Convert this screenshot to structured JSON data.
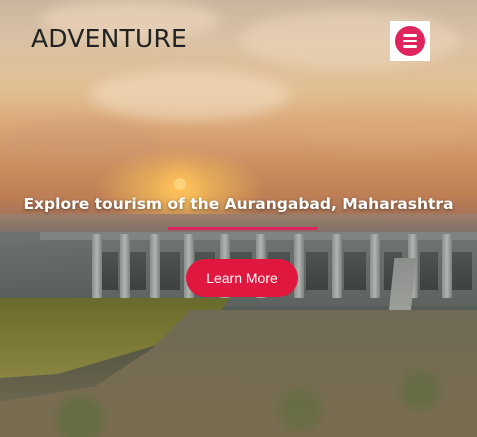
{
  "header": {
    "brand": "ADVENTURE",
    "menu_icon": "hamburger-menu-icon"
  },
  "hero": {
    "title": "Explore tourism of the Aurangabad, Maharashtra",
    "cta_label": "Learn More"
  },
  "colors": {
    "accent": "#e0245e",
    "button": "#e0183f",
    "brand_text": "#222222"
  }
}
